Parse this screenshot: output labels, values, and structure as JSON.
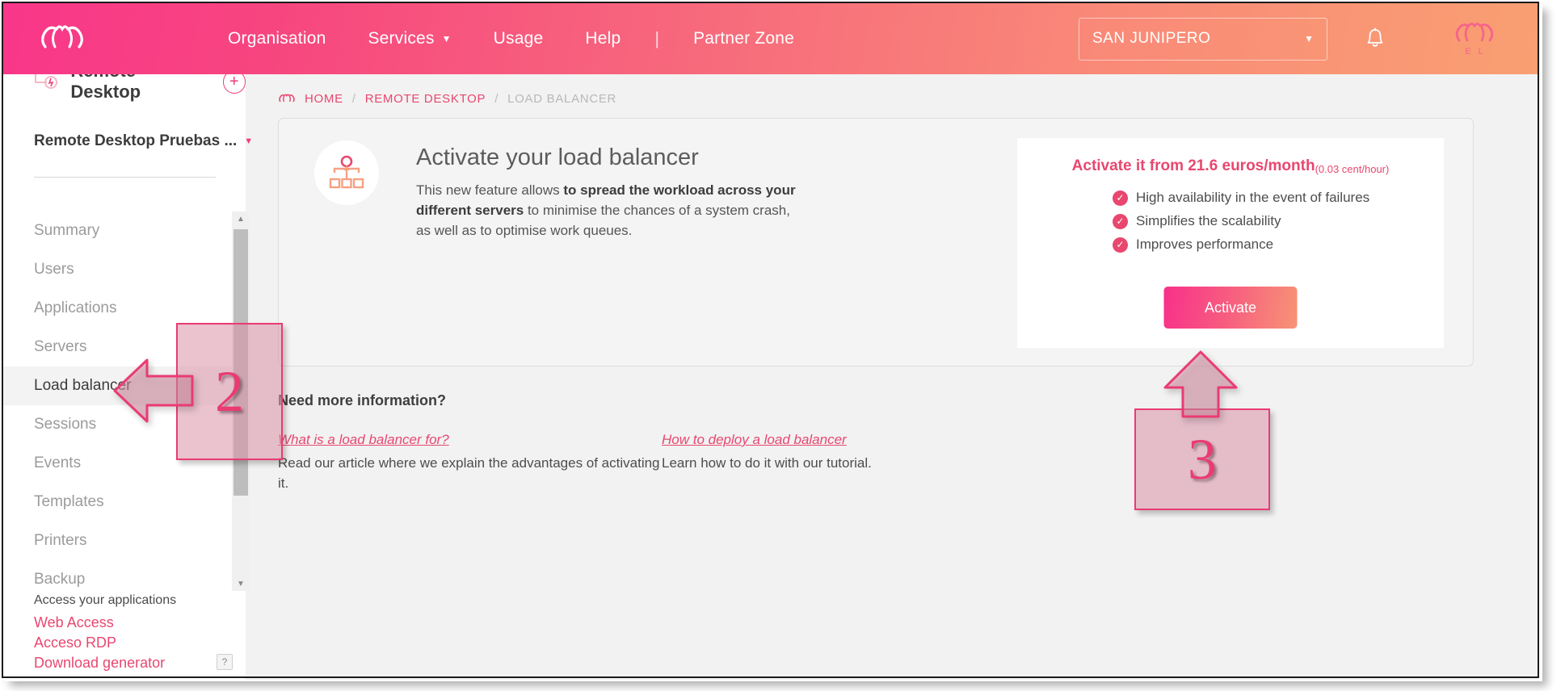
{
  "topnav": {
    "logo_icon": "cloud-logo-icon",
    "links": [
      {
        "label": "Organisation",
        "has_caret": false
      },
      {
        "label": "Services",
        "has_caret": true
      },
      {
        "label": "Usage",
        "has_caret": false
      },
      {
        "label": "Help",
        "has_caret": false
      }
    ],
    "separator": "|",
    "partner_zone": "Partner Zone",
    "org_selector": {
      "value": "SAN JUNIPERO",
      "caret": "▼"
    },
    "bell_icon": "notification-bell-icon",
    "avatar": {
      "icon": "cloud-avatar-icon",
      "sub_label": "E L"
    }
  },
  "sidebar": {
    "title": "Remote Desktop",
    "title_icon": "remote-desktop-icon",
    "add_button": "+",
    "group_name": "Remote Desktop Pruebas ...",
    "group_caret": "▼",
    "items": [
      {
        "label": "Summary",
        "active": false
      },
      {
        "label": "Users",
        "active": false
      },
      {
        "label": "Applications",
        "active": false
      },
      {
        "label": "Servers",
        "active": false
      },
      {
        "label": "Load balancer",
        "active": true
      },
      {
        "label": "Sessions",
        "active": false
      },
      {
        "label": "Events",
        "active": false
      },
      {
        "label": "Templates",
        "active": false
      },
      {
        "label": "Printers",
        "active": false
      },
      {
        "label": "Backup",
        "active": false
      }
    ],
    "bottom": {
      "title": "Access your applications",
      "links": [
        "Web Access",
        "Acceso RDP",
        "Download generator"
      ],
      "help_label": "?"
    },
    "scrollbar": {
      "up_arrow": "▲",
      "down_arrow": "▼"
    }
  },
  "breadcrumb": {
    "icon": "cloud-home-icon",
    "items": [
      "HOME",
      "REMOTE DESKTOP",
      "LOAD BALANCER"
    ],
    "separator": "/"
  },
  "main_card": {
    "icon": "load-balancer-tree-icon",
    "title": "Activate your load balancer",
    "description_part1": "This new feature allows ",
    "description_bold": "to spread the workload across your different servers",
    "description_part2": " to minimise the chances of a system crash, as well as to optimise work queues.",
    "offer": {
      "price_main": "Activate it from 21.6 euros/month",
      "price_sub": "(0.03 cent/hour)",
      "benefits": [
        "High availability in the event of failures",
        "Simplifies the scalability",
        "Improves performance"
      ],
      "check_icon": "check-circle-icon",
      "activate_label": "Activate"
    }
  },
  "info": {
    "heading": "Need more information?",
    "columns": [
      {
        "link": "What is a load balancer for?",
        "text": "Read our article where we explain the advantages of activating it."
      },
      {
        "link": "How to deploy a load balancer",
        "text": "Learn how to do it with our tutorial."
      }
    ]
  },
  "annotations": [
    {
      "id": "2",
      "label": "2",
      "points_to": "sidebar-item-load-balancer"
    },
    {
      "id": "3",
      "label": "3",
      "points_to": "activate-button"
    }
  ],
  "colors": {
    "brand_pink": "#f8308a",
    "brand_orange": "#f79475",
    "accent": "#e8476f",
    "annotation_border": "#ea3b72",
    "content_bg": "#f2f2f2"
  }
}
